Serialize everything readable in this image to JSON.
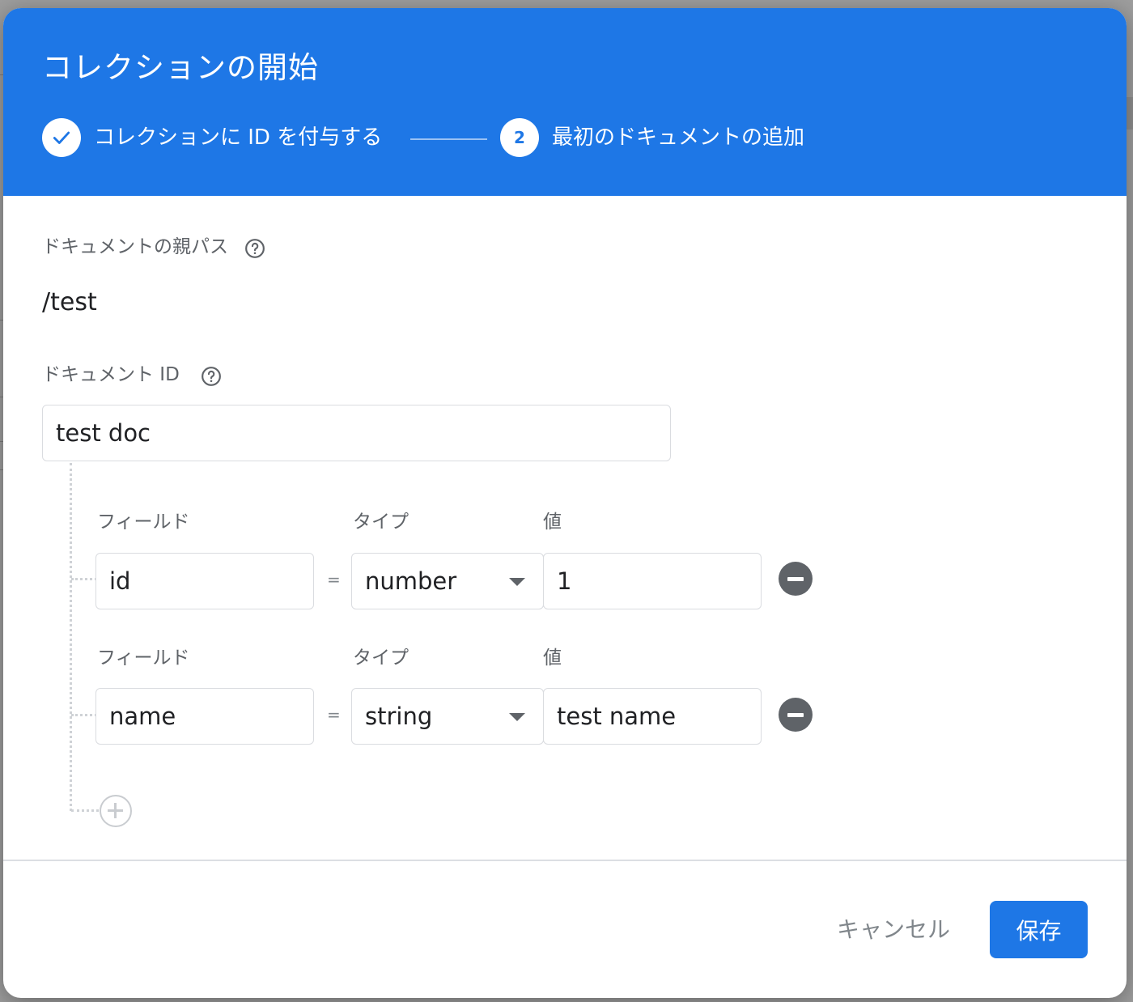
{
  "dialog": {
    "title": "コレクションの開始",
    "steps": [
      {
        "label": "コレクションに ID を付与する",
        "status": "complete",
        "icon": "check-icon"
      },
      {
        "number": "2",
        "label": "最初のドキュメントの追加",
        "status": "active"
      }
    ]
  },
  "form": {
    "parent_path_label": "ドキュメントの親パス",
    "parent_path_value": "/test",
    "document_id_label": "ドキュメント ID",
    "document_id_value": "test doc",
    "fields": [
      {
        "field_label": "フィールド",
        "type_label": "タイプ",
        "value_label": "値",
        "name": "id",
        "type": "number",
        "value": "1"
      },
      {
        "field_label": "フィールド",
        "type_label": "タイプ",
        "value_label": "値",
        "name": "name",
        "type": "string",
        "value": "test name"
      }
    ],
    "equals": "="
  },
  "footer": {
    "cancel_label": "キャンセル",
    "save_label": "保存"
  },
  "colors": {
    "header_bg": "#1e77e6",
    "primary_button": "#1e77e6"
  }
}
